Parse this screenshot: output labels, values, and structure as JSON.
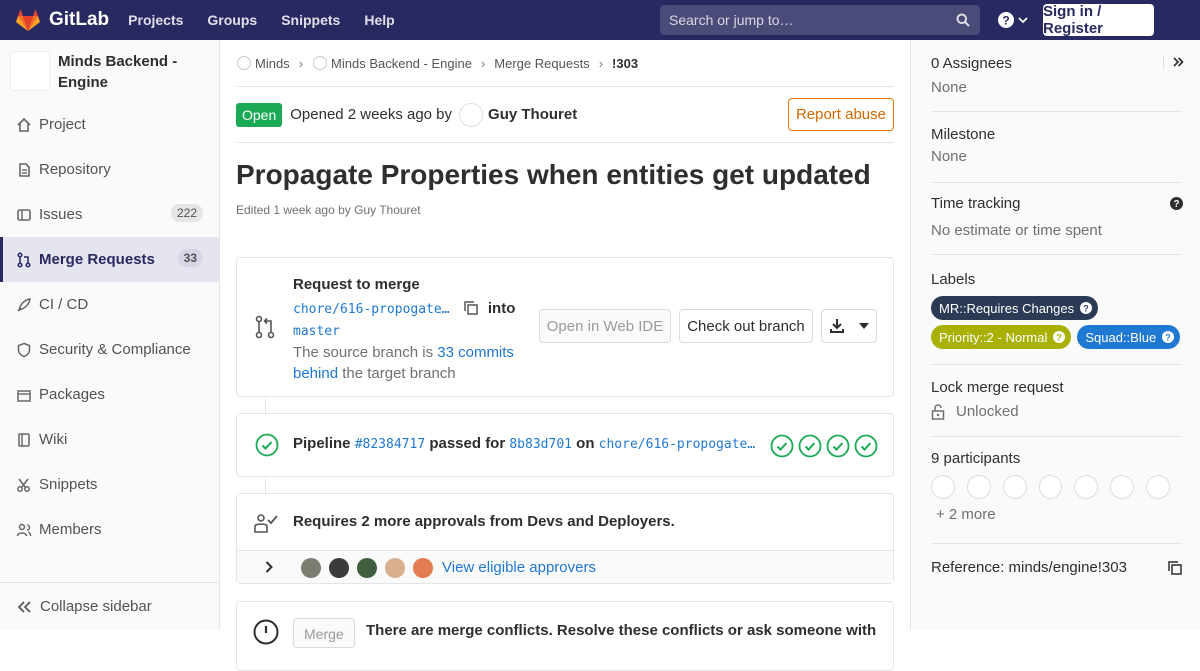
{
  "nav": {
    "brand": "GitLab",
    "links": [
      "Projects",
      "Groups",
      "Snippets",
      "Help"
    ],
    "search_placeholder": "Search or jump to…",
    "signin": "Sign in / Register"
  },
  "sidebar": {
    "project_name": "Minds Backend - Engine",
    "items": [
      {
        "label": "Project",
        "icon": "home-icon"
      },
      {
        "label": "Repository",
        "icon": "doc-icon"
      },
      {
        "label": "Issues",
        "count": "222",
        "icon": "issues-icon"
      },
      {
        "label": "Merge Requests",
        "count": "33",
        "icon": "merge-request-icon",
        "active": true
      },
      {
        "label": "CI / CD",
        "icon": "rocket-icon"
      },
      {
        "label": "Security & Compliance",
        "icon": "shield-icon"
      },
      {
        "label": "Packages",
        "icon": "package-icon"
      },
      {
        "label": "Wiki",
        "icon": "book-icon"
      },
      {
        "label": "Snippets",
        "icon": "scissors-icon"
      },
      {
        "label": "Members",
        "icon": "users-icon"
      }
    ],
    "collapse": "Collapse sidebar"
  },
  "breadcrumb": [
    "Minds",
    "Minds Backend - Engine",
    "Merge Requests",
    "!303"
  ],
  "mr": {
    "status": "Open",
    "opened": "Opened 2 weeks ago by",
    "author": "Guy Thouret",
    "report": "Report abuse",
    "title": "Propagate Properties when entities get updated",
    "edited": "Edited 1 week ago by Guy Thouret"
  },
  "merge_box": {
    "heading": "Request to merge",
    "source_branch": "chore/616-propogate…",
    "into": "into",
    "target_branch": "master",
    "behind_prefix": "The source branch is",
    "behind_link": "33 commits behind",
    "behind_suffix": "the target branch",
    "open_ide": "Open in Web IDE",
    "checkout": "Check out branch"
  },
  "pipeline": {
    "label": "Pipeline",
    "id": "#82384717",
    "passed_for": "passed for",
    "sha": "8b83d701",
    "on": "on",
    "branch": "chore/616-propogate…"
  },
  "approvals": {
    "text": "Requires 2 more approvals from Devs and Deployers.",
    "link": "View eligible approvers"
  },
  "conflicts": {
    "button": "Merge",
    "text": "There are merge conflicts. Resolve these conflicts or ask someone with"
  },
  "right": {
    "assignees_title": "0 Assignees",
    "assignees_value": "None",
    "milestone_title": "Milestone",
    "milestone_value": "None",
    "time_title": "Time tracking",
    "time_value": "No estimate or time spent",
    "labels_title": "Labels",
    "labels": [
      {
        "text": "MR::Requires Changes",
        "color": "#2b3a55"
      },
      {
        "text": "Priority::2 - Normal",
        "color": "#a8b100"
      },
      {
        "text": "Squad::Blue",
        "color": "#1f78d1"
      }
    ],
    "lock_title": "Lock merge request",
    "lock_value": "Unlocked",
    "participants_title": "9 participants",
    "more": "+ 2 more",
    "reference": "Reference: minds/engine!303"
  }
}
